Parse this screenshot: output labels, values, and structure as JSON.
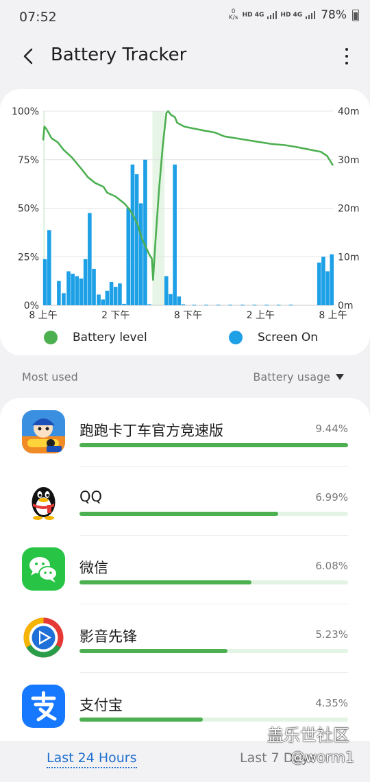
{
  "status_bar": {
    "time": "07:52",
    "net_speed": "0 K/s",
    "sim1": "HD 4G",
    "sim2": "HD 4G",
    "battery_percent": "78%"
  },
  "header": {
    "title": "Battery Tracker",
    "back_icon": "back-arrow-icon",
    "more_icon": "more-vertical-icon"
  },
  "chart_data": {
    "type": "line+bar",
    "x_tick_labels": [
      "8 上午",
      "2 下午",
      "8 下午",
      "2 上午",
      "8 上午"
    ],
    "y_left_ticks": [
      "100%",
      "75%",
      "50%",
      "25%",
      "0%"
    ],
    "y_right_ticks": [
      "40m",
      "30m",
      "20m",
      "10m",
      "0m"
    ],
    "y_left_range": [
      0,
      100
    ],
    "y_right_range": [
      0,
      40
    ],
    "x_range_hours": [
      0,
      24
    ],
    "grid": true,
    "series": [
      {
        "name": "Battery level",
        "kind": "line",
        "color": "#4caf50",
        "points": [
          [
            0.0,
            85
          ],
          [
            0.1,
            92
          ],
          [
            0.25,
            91
          ],
          [
            0.7,
            86
          ],
          [
            1.2,
            84
          ],
          [
            1.7,
            80
          ],
          [
            2.4,
            76
          ],
          [
            3.2,
            70
          ],
          [
            3.7,
            66
          ],
          [
            4.3,
            63
          ],
          [
            5.0,
            61
          ],
          [
            5.3,
            58
          ],
          [
            6.0,
            56
          ],
          [
            6.8,
            52
          ],
          [
            7.3,
            48
          ],
          [
            7.8,
            42
          ],
          [
            8.2,
            34
          ],
          [
            8.5,
            30
          ],
          [
            8.8,
            26
          ],
          [
            9.0,
            24
          ],
          [
            9.1,
            13
          ],
          [
            9.3,
            33
          ],
          [
            9.6,
            60
          ],
          [
            9.9,
            82
          ],
          [
            10.2,
            99
          ],
          [
            10.35,
            100
          ],
          [
            10.6,
            98
          ],
          [
            10.9,
            97
          ],
          [
            11.1,
            94
          ],
          [
            11.7,
            92
          ],
          [
            12.5,
            91
          ],
          [
            13.3,
            90
          ],
          [
            14.2,
            89
          ],
          [
            15.0,
            87
          ],
          [
            16.0,
            86
          ],
          [
            17.0,
            85
          ],
          [
            18.0,
            84
          ],
          [
            19.0,
            83
          ],
          [
            20.0,
            82.5
          ],
          [
            21.0,
            81.5
          ],
          [
            21.8,
            80.5
          ],
          [
            23.0,
            79
          ],
          [
            23.5,
            77
          ],
          [
            24.0,
            72
          ]
        ]
      },
      {
        "name": "Screen On",
        "kind": "bar",
        "color": "#1ea0e6",
        "unit": "minutes",
        "bars": [
          [
            0.15,
            9.5
          ],
          [
            0.5,
            15.5
          ],
          [
            1.3,
            5.0
          ],
          [
            1.7,
            2.5
          ],
          [
            2.1,
            7.0
          ],
          [
            2.45,
            6.5
          ],
          [
            2.8,
            6.0
          ],
          [
            3.15,
            5.5
          ],
          [
            3.5,
            9.5
          ],
          [
            3.85,
            19.0
          ],
          [
            4.2,
            7.5
          ],
          [
            4.6,
            2.2
          ],
          [
            4.95,
            1.2
          ],
          [
            5.3,
            3.0
          ],
          [
            5.65,
            4.8
          ],
          [
            6.0,
            3.8
          ],
          [
            6.35,
            4.5
          ],
          [
            6.7,
            0.3
          ],
          [
            7.05,
            20.0
          ],
          [
            7.4,
            29.0
          ],
          [
            7.75,
            27.0
          ],
          [
            8.1,
            21.0
          ],
          [
            8.45,
            30.0
          ],
          [
            8.8,
            0.2
          ],
          [
            10.2,
            6.0
          ],
          [
            10.55,
            2.3
          ],
          [
            10.9,
            29.0
          ],
          [
            11.25,
            1.8
          ],
          [
            11.6,
            0.2
          ],
          [
            12.5,
            0.1
          ],
          [
            13.5,
            0.1
          ],
          [
            14.5,
            0.1
          ],
          [
            15.5,
            0.1
          ],
          [
            16.5,
            0.1
          ],
          [
            17.5,
            0.1
          ],
          [
            18.5,
            0.1
          ],
          [
            19.5,
            0.1
          ],
          [
            20.5,
            0.1
          ],
          [
            22.85,
            8.8
          ],
          [
            23.2,
            10.0
          ],
          [
            23.55,
            7.0
          ],
          [
            23.9,
            10.5
          ]
        ]
      }
    ],
    "shaded_intervals_hours": [
      [
        0.0,
        0.15
      ],
      [
        9.05,
        10.05
      ]
    ],
    "legend": [
      {
        "label": "Battery level",
        "color": "#4caf50"
      },
      {
        "label": "Screen On",
        "color": "#1ea0e6"
      }
    ],
    "legend_placement": "bottom"
  },
  "section": {
    "left_label": "Most used",
    "sort_label": "Battery usage"
  },
  "apps": [
    {
      "name": "跑跑卡丁车官方竞速版",
      "percent": "9.44%",
      "share": 1.0,
      "icon": "kart-racing-icon"
    },
    {
      "name": "QQ",
      "percent": "6.99%",
      "share": 0.74,
      "icon": "qq-penguin-icon"
    },
    {
      "name": "微信",
      "percent": "6.08%",
      "share": 0.64,
      "icon": "wechat-icon"
    },
    {
      "name": "影音先锋",
      "percent": "5.23%",
      "share": 0.55,
      "icon": "player-icon"
    },
    {
      "name": "支付宝",
      "percent": "4.35%",
      "share": 0.46,
      "icon": "alipay-icon"
    }
  ],
  "bottom_tabs": {
    "tab_24h": "Last 24 Hours",
    "tab_7d": "Last 7 Days"
  },
  "watermark": {
    "top": "盖乐世社区",
    "bottom": "@worm1"
  }
}
